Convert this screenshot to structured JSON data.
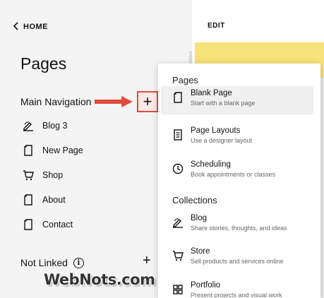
{
  "left_panel": {
    "home_label": "HOME",
    "pages_title": "Pages",
    "main_navigation_title": "Main Navigation",
    "nav_items": [
      {
        "label": "Blog 3",
        "icon": "blog-icon"
      },
      {
        "label": "New Page",
        "icon": "page-icon"
      },
      {
        "label": "Shop",
        "icon": "cart-icon"
      },
      {
        "label": "About",
        "icon": "page-icon"
      },
      {
        "label": "Contact",
        "icon": "page-icon"
      }
    ],
    "not_linked_title": "Not Linked",
    "info_glyph": "i",
    "plus_glyph": "+"
  },
  "editor": {
    "edit_label": "EDIT"
  },
  "dropdown": {
    "pages_heading": "Pages",
    "collections_heading": "Collections",
    "pages_items": [
      {
        "title": "Blank Page",
        "subtitle": "Start with a blank page",
        "icon": "page-icon"
      },
      {
        "title": "Page Layouts",
        "subtitle": "Use a designer layout",
        "icon": "document-icon"
      },
      {
        "title": "Scheduling",
        "subtitle": "Book appointments or classes",
        "icon": "clock-icon"
      }
    ],
    "collection_items": [
      {
        "title": "Blog",
        "subtitle": "Share stories, thoughts, and ideas",
        "icon": "blog-icon"
      },
      {
        "title": "Store",
        "subtitle": "Sell products and services online",
        "icon": "cart-icon"
      },
      {
        "title": "Portfolio",
        "subtitle": "Present projects and visual work",
        "icon": "grid-icon"
      }
    ]
  },
  "watermark": "WebNots.com",
  "colors": {
    "highlight_red": "#e04b3c",
    "accent_yellow": "#f7e27a",
    "panel_bg": "#f4f4f4"
  }
}
